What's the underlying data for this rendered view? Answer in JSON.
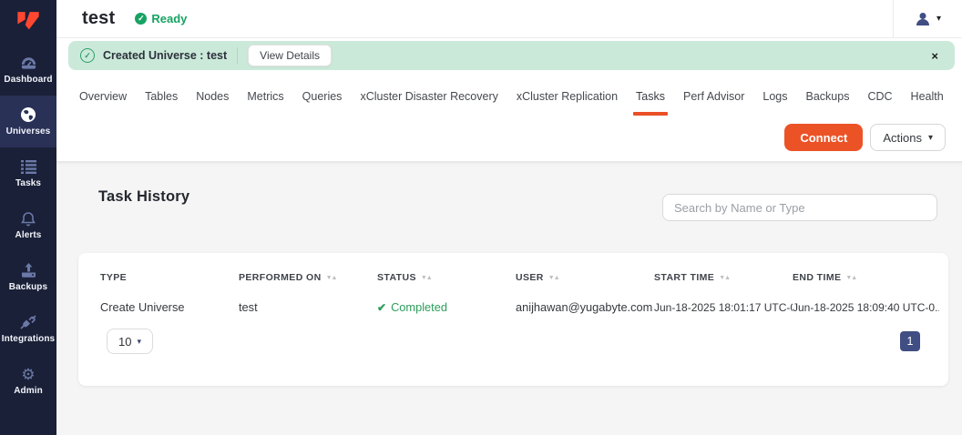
{
  "sidebar": {
    "items": [
      {
        "label": "Dashboard",
        "icon": "dashboard-icon",
        "active": false
      },
      {
        "label": "Universes",
        "icon": "universes-icon",
        "active": true
      },
      {
        "label": "Tasks",
        "icon": "tasks-icon",
        "active": false
      },
      {
        "label": "Alerts",
        "icon": "alerts-icon",
        "active": false
      },
      {
        "label": "Backups",
        "icon": "backups-icon",
        "active": false
      },
      {
        "label": "Integrations",
        "icon": "integrations-icon",
        "active": false
      },
      {
        "label": "Admin",
        "icon": "admin-icon",
        "active": false
      }
    ]
  },
  "header": {
    "title": "test",
    "status_label": "Ready"
  },
  "banner": {
    "message": "Created Universe : test",
    "view_details_label": "View Details"
  },
  "tabs": [
    "Overview",
    "Tables",
    "Nodes",
    "Metrics",
    "Queries",
    "xCluster Disaster Recovery",
    "xCluster Replication",
    "Tasks",
    "Perf Advisor",
    "Logs",
    "Backups",
    "CDC",
    "Health"
  ],
  "active_tab": "Tasks",
  "toolbar": {
    "connect_label": "Connect",
    "actions_label": "Actions"
  },
  "task_history": {
    "title": "Task History",
    "search_placeholder": "Search by Name or Type",
    "columns": [
      {
        "label": "TYPE",
        "sortable": false
      },
      {
        "label": "PERFORMED ON",
        "sortable": true
      },
      {
        "label": "STATUS",
        "sortable": true
      },
      {
        "label": "USER",
        "sortable": true
      },
      {
        "label": "START TIME",
        "sortable": true
      },
      {
        "label": "END TIME",
        "sortable": true
      }
    ],
    "rows": [
      {
        "type": "Create Universe",
        "performed_on": "test",
        "status": "Completed",
        "user": "anijhawan@yugabyte.com",
        "start_time": "Jun-18-2025 18:01:17 UTC-0...",
        "end_time": "Jun-18-2025 18:09:40 UTC-0..."
      }
    ],
    "pagination": {
      "page_size": "10",
      "current_page": "1"
    }
  },
  "icons": {
    "caret": "▾",
    "sort": "▼▲",
    "close": "×",
    "check": "✓",
    "check_bold": "✔",
    "gear": "⚙"
  },
  "colors": {
    "accent_orange": "#eb5327",
    "sidebar_navy": "#1a2037",
    "sidebar_active": "#2a3157",
    "success_green": "#2b9e5a",
    "banner_green_bg": "#cbe9d9",
    "pagination_navy": "#414e84"
  }
}
